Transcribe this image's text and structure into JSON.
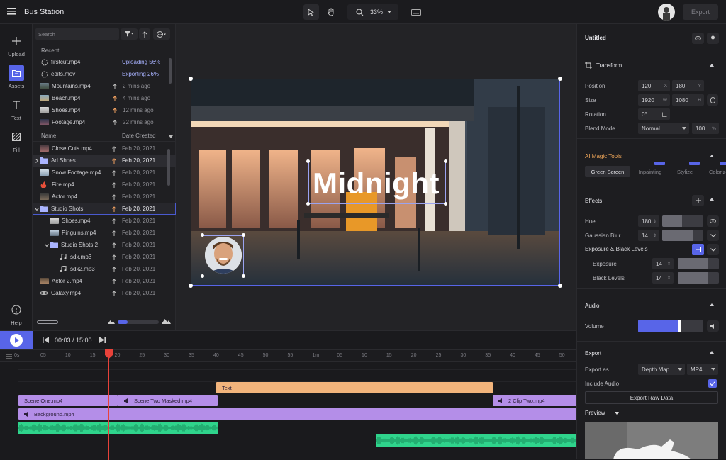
{
  "app": {
    "title": "Bus Station",
    "zoom": "33%",
    "export_label": "Export"
  },
  "rail": {
    "upload": "Upload",
    "assets": "Assets",
    "text": "Text",
    "fill": "Fill",
    "help": "Help"
  },
  "assets": {
    "search_placeholder": "Search",
    "processing": [
      {
        "name": "firstcut.mp4",
        "status": "Uploading 56%"
      },
      {
        "name": "edits.mov",
        "status": "Exporting 26%"
      }
    ],
    "recent": [
      {
        "name": "Mountains.mp4",
        "time": "2 mins ago"
      },
      {
        "name": "Beach.mp4",
        "time": "4 mins ago"
      },
      {
        "name": "Shoes.mp4",
        "time": "12 mins ago"
      },
      {
        "name": "Footage.mp4",
        "time": "22 mins ago"
      }
    ],
    "col_name": "Name",
    "col_date": "Date Created",
    "files": [
      {
        "name": "Close Cuts.mp4",
        "date": "Feb 20, 2021"
      },
      {
        "name": "Ad Shoes",
        "date": "Feb 20, 2021"
      },
      {
        "name": "Snow Footage.mp4",
        "date": "Feb 20, 2021"
      },
      {
        "name": "Fire.mp4",
        "date": "Feb 20, 2021"
      },
      {
        "name": "Actor.mp4",
        "date": "Feb 20, 2021"
      },
      {
        "name": "Studio Shots",
        "date": "Feb 20, 2021"
      },
      {
        "name": "Shoes.mp4",
        "date": "Feb 20, 2021"
      },
      {
        "name": "Pinguins.mp4",
        "date": "Feb 20, 2021"
      },
      {
        "name": "Studio Shots 2",
        "date": "Feb 20, 2021"
      },
      {
        "name": "sdx.mp3",
        "date": "Feb 20, 2021"
      },
      {
        "name": "sdx2.mp3",
        "date": "Feb 20, 2021"
      },
      {
        "name": "Actor 2.mp4",
        "date": "Feb 20, 2021"
      },
      {
        "name": "Galaxy.mp4",
        "date": "Feb 20, 2021"
      }
    ]
  },
  "canvas": {
    "overlay_text": "Midnight"
  },
  "player": {
    "timecode": "00:03 / 15:00"
  },
  "ruler": [
    "05",
    "10",
    "15",
    "20",
    "25",
    "30",
    "35",
    "40",
    "45",
    "50",
    "55",
    "1m",
    "05",
    "10",
    "15",
    "20",
    "25",
    "30",
    "35",
    "40",
    "45",
    "50"
  ],
  "tracks": {
    "text_clip": "Text",
    "scene_one": "Scene One.mp4",
    "scene_two": "Scene Two Masked.mp4",
    "clip_two": "2 Clip Two.mp4",
    "background": "Background.mp4"
  },
  "inspector": {
    "doc_title": "Untitled",
    "transform": {
      "title": "Transform",
      "position_label": "Position",
      "pos_x": "120",
      "pos_y": "180",
      "size_label": "Size",
      "size_w": "1920",
      "size_h": "1080",
      "rotation_label": "Rotation",
      "rotation": "0°",
      "blend_label": "Blend Mode",
      "blend": "Normal",
      "opacity": "100",
      "unit_x": "X",
      "unit_y": "Y",
      "unit_w": "W",
      "unit_h": "H",
      "unit_pct": "%"
    },
    "ai": {
      "title": "AI Magic Tools",
      "tools": [
        "Green Screen",
        "Inpainting",
        "Stylize",
        "Colorize"
      ]
    },
    "effects": {
      "title": "Effects",
      "hue_label": "Hue",
      "hue": "180",
      "blur_label": "Gaussian Blur",
      "blur": "14",
      "exposure_group": "Exposure & Black Levels",
      "exposure_label": "Exposure",
      "exposure": "14",
      "black_label": "Black Levels",
      "black": "14"
    },
    "audio": {
      "title": "Audio",
      "volume_label": "Volume",
      "volume_level": 0.63
    },
    "export": {
      "title": "Export",
      "export_as_label": "Export as",
      "format_a": "Depth Map",
      "format_b": "MP4",
      "include_audio_label": "Include Audio",
      "raw_button": "Export Raw Data",
      "preview_label": "Preview"
    }
  },
  "colors": {
    "accent": "#5865e8",
    "clip_purple": "#b48ee8",
    "clip_orange": "#f2b47c",
    "audio_green": "#2fd48c",
    "playhead": "#e8423a"
  }
}
